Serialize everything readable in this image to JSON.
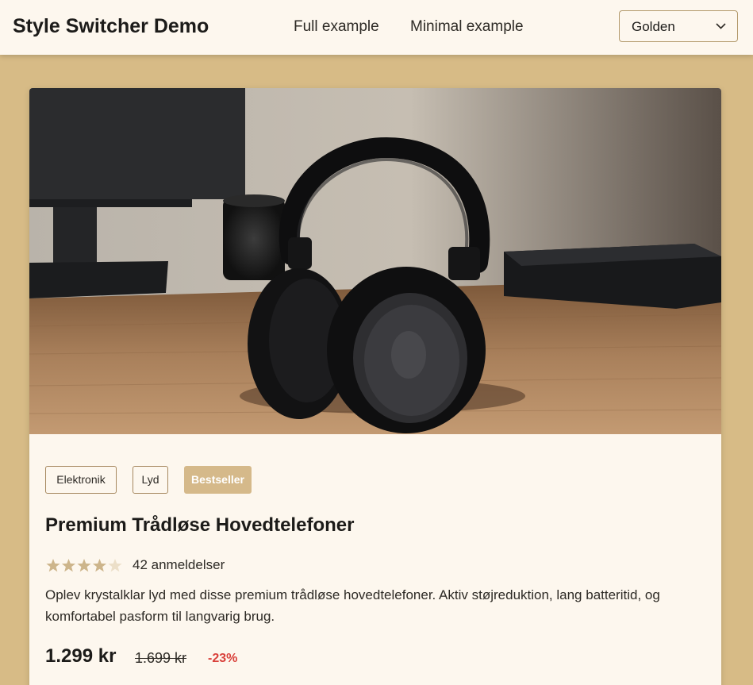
{
  "header": {
    "brand": "Style Switcher Demo",
    "nav": {
      "full": "Full example",
      "minimal": "Minimal example"
    },
    "style_select": {
      "selected": "Golden"
    }
  },
  "product": {
    "tags": [
      {
        "label": "Elektronik"
      },
      {
        "label": "Lyd"
      },
      {
        "label": "Bestseller"
      }
    ],
    "title": "Premium Trådløse Hovedtelefoner",
    "rating": {
      "stars": 4,
      "max": 5,
      "count_label": "42 anmeldelser"
    },
    "description": "Oplev krystalklar lyd med disse premium trådløse hovedtelefoner. Aktiv støjreduktion, lang batteritid, og komfortabel pasform til langvarig brug.",
    "price": "1.299 kr",
    "old_price": "1.699 kr",
    "discount": "-23%"
  },
  "colors": {
    "accent": "#d5b98a",
    "page_background": "#d7bb86",
    "card_background": "#fdf7ee",
    "star_filled": "#cdb58b",
    "star_empty": "#ecdfc8",
    "discount": "#d9403a"
  },
  "icons": {
    "select_arrow": "chevron-down-icon",
    "rating_star": "star-icon"
  }
}
